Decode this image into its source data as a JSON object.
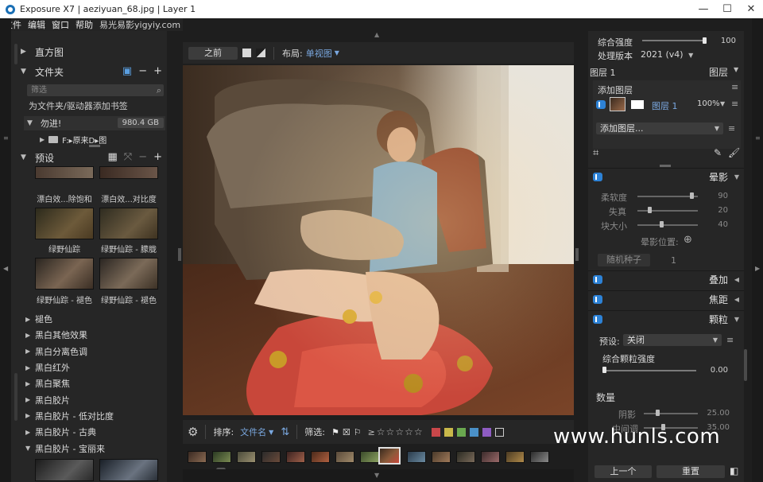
{
  "window": {
    "title": "Exposure X7 | aeziyuan_68.jpg | Layer 1",
    "minimize": "—",
    "maximize": "☐",
    "close": "✕"
  },
  "menu": {
    "items": [
      "文件",
      "编辑",
      "窗口",
      "帮助"
    ],
    "overlay_text": "易光易影yigyiy.com"
  },
  "left_panel": {
    "histogram_label": "直方图",
    "folders_label": "文件夹",
    "search_placeholder": "筛选",
    "add_bookmark": "为文件夹/驱动器添加书签",
    "drive_name": "勿进!",
    "drive_size": "980.4 GB",
    "folder_path": "F:▸原来D▸图",
    "presets_label": "预设",
    "thumbs": [
      {
        "label": "漂白效...除饱和"
      },
      {
        "label": "漂白效...对比度"
      },
      {
        "label": "绿野仙踪"
      },
      {
        "label": "绿野仙踪 - 朦胧"
      },
      {
        "label": "绿野仙踪 - 褪色"
      },
      {
        "label": "绿野仙踪 - 褪色"
      }
    ],
    "preset_groups": [
      {
        "label": "褪色",
        "expanded": false
      },
      {
        "label": "黑白其他效果",
        "expanded": false
      },
      {
        "label": "黑白分离色调",
        "expanded": false
      },
      {
        "label": "黑白红外",
        "expanded": false
      },
      {
        "label": "黑白聚焦",
        "expanded": false
      },
      {
        "label": "黑白胶片",
        "expanded": false
      },
      {
        "label": "黑白胶片 - 低对比度",
        "expanded": false
      },
      {
        "label": "黑白胶片 - 古典",
        "expanded": false
      },
      {
        "label": "黑白胶片 - 宝丽来",
        "expanded": true
      }
    ]
  },
  "toolbar": {
    "before_label": "之前",
    "layout_label": "布局:",
    "layout_value": "单视图"
  },
  "filmbar": {
    "sort_label": "排序:",
    "sort_value": "文件名",
    "filter_label": "筛选:",
    "stars_prefix": "≥",
    "stars": "☆☆☆☆☆",
    "colors": [
      "#c8474a",
      "#c9b84a",
      "#6aa84f",
      "#4a90c8",
      "#8e5cc2"
    ]
  },
  "right_panel": {
    "overall_strength_label": "综合强度",
    "overall_strength_value": "100",
    "overall_strength": 1.0,
    "process_version_label": "处理版本",
    "process_version_value": "2021 (v4)",
    "layers_title": "图层 1",
    "layers_section": "图层",
    "add_layer_label": "添加图层",
    "layer_name": "图层 1",
    "layer_opacity": "100%",
    "add_layer_dropdown": "添加图层...",
    "vignette_section": "晕影",
    "softness_label": "柔软度",
    "softness_value": "90",
    "softness": 0.9,
    "falloff_label": "失真",
    "falloff_value": "20",
    "falloff": 0.2,
    "blocksize_label": "块大小",
    "blocksize_value": "40",
    "blocksize": 0.4,
    "vignette_pos_label": "晕影位置:",
    "random_seed_btn": "随机种子",
    "random_seed_value": "1",
    "overlay_section": "叠加",
    "focus_section": "焦距",
    "grain_section": "颗粒",
    "grain_preset_label": "预设:",
    "grain_preset_value": "关闭",
    "grain_strength_label": "综合颗粒强度",
    "grain_strength_value": "0.00",
    "grain_strength": 0.0,
    "amount_label": "数量",
    "shadow_label": "阴影",
    "shadow_value": "25.00",
    "shadow": 0.25,
    "midtone_label": "中间调",
    "midtone_value": "35.00",
    "midtone": 0.35,
    "prev_btn": "上一个",
    "reset_btn": "重置"
  },
  "watermark": "www.hunls.com"
}
